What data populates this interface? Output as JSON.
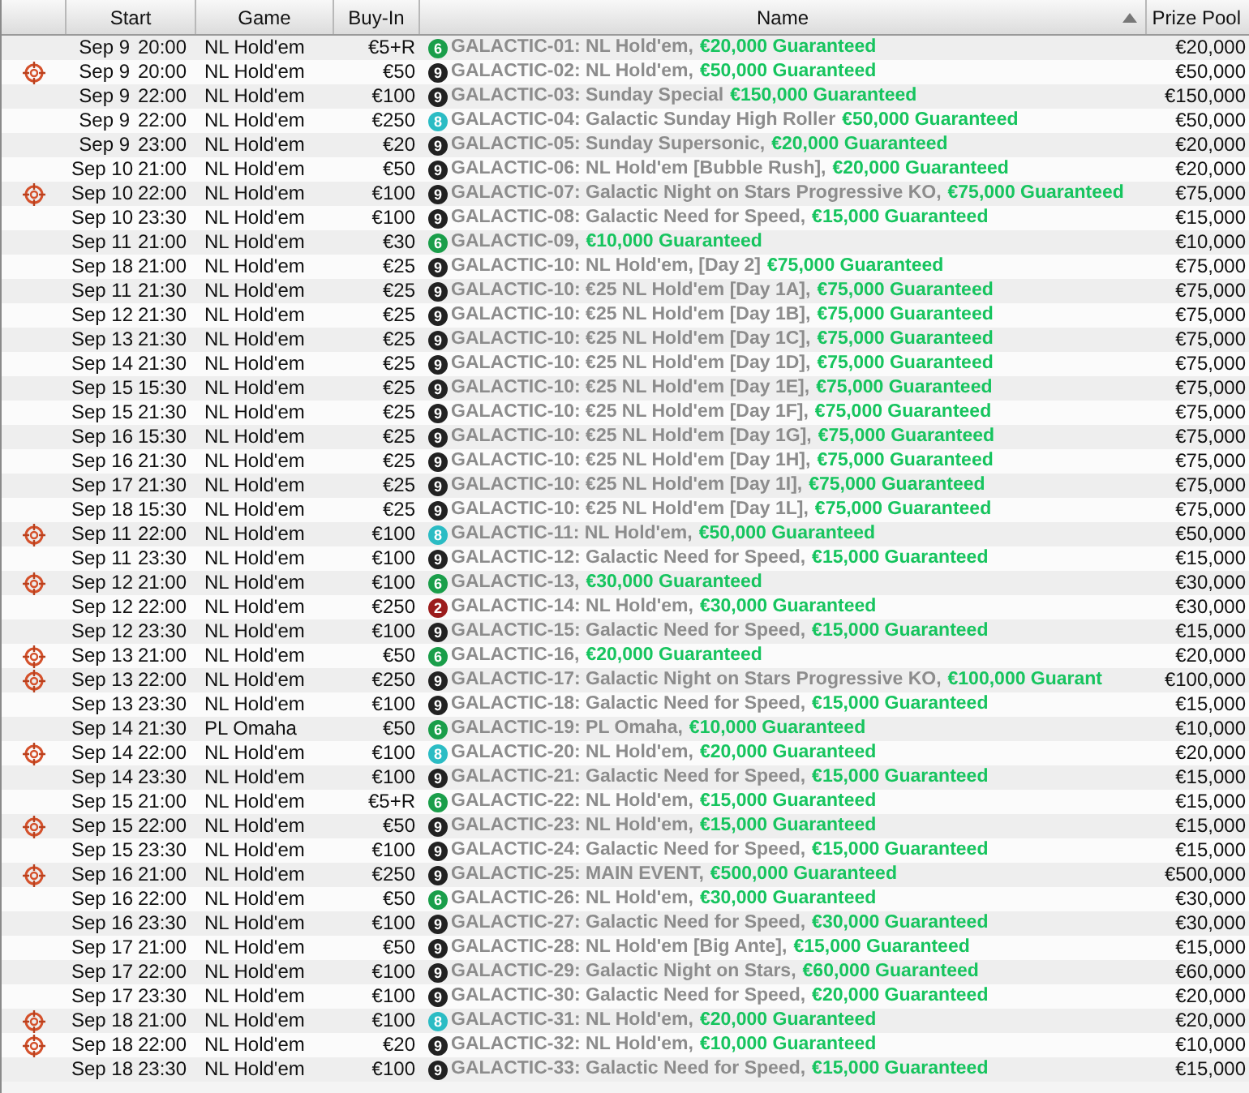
{
  "table": {
    "columns": [
      {
        "label": "Start"
      },
      {
        "label": "Game"
      },
      {
        "label": "Buy-In"
      },
      {
        "label": "Name",
        "sorted": true
      },
      {
        "label": "Prize Pool"
      }
    ],
    "rows": [
      {
        "marked": false,
        "date": "Sep 9",
        "time": "20:00",
        "game": "NL Hold'em",
        "buy_in": "€5+R",
        "seats": "6",
        "color": "#1a9e4a",
        "title": "GALACTIC-01: NL Hold'em,",
        "guarantee": "€20,000 Guaranteed",
        "prize_pool": "€20,000"
      },
      {
        "marked": true,
        "date": "Sep 9",
        "time": "20:00",
        "game": "NL Hold'em",
        "buy_in": "€50",
        "seats": "9",
        "color": "#222222",
        "title": "GALACTIC-02: NL Hold'em,",
        "guarantee": "€50,000 Guaranteed",
        "prize_pool": "€50,000"
      },
      {
        "marked": false,
        "date": "Sep 9",
        "time": "22:00",
        "game": "NL Hold'em",
        "buy_in": "€100",
        "seats": "9",
        "color": "#222222",
        "title": "GALACTIC-03: Sunday Special",
        "guarantee": "€150,000 Guaranteed",
        "prize_pool": "€150,000"
      },
      {
        "marked": false,
        "date": "Sep 9",
        "time": "22:00",
        "game": "NL Hold'em",
        "buy_in": "€250",
        "seats": "8",
        "color": "#2bbcc4",
        "title": "GALACTIC-04: Galactic Sunday High Roller",
        "guarantee": "€50,000 Guaranteed",
        "prize_pool": "€50,000"
      },
      {
        "marked": false,
        "date": "Sep 9",
        "time": "23:00",
        "game": "NL Hold'em",
        "buy_in": "€20",
        "seats": "9",
        "color": "#222222",
        "title": "GALACTIC-05: Sunday Supersonic,",
        "guarantee": "€20,000 Guaranteed",
        "prize_pool": "€20,000"
      },
      {
        "marked": false,
        "date": "Sep 10",
        "time": "21:00",
        "game": "NL Hold'em",
        "buy_in": "€50",
        "seats": "9",
        "color": "#222222",
        "title": "GALACTIC-06: NL Hold'em [Bubble Rush],",
        "guarantee": "€20,000 Guaranteed",
        "prize_pool": "€20,000"
      },
      {
        "marked": true,
        "date": "Sep 10",
        "time": "22:00",
        "game": "NL Hold'em",
        "buy_in": "€100",
        "seats": "9",
        "color": "#222222",
        "title": "GALACTIC-07: Galactic Night on Stars Progressive KO,",
        "guarantee": "€75,000 Guaranteed",
        "prize_pool": "€75,000"
      },
      {
        "marked": false,
        "date": "Sep 10",
        "time": "23:30",
        "game": "NL Hold'em",
        "buy_in": "€100",
        "seats": "9",
        "color": "#222222",
        "title": "GALACTIC-08: Galactic Need for Speed,",
        "guarantee": "€15,000 Guaranteed",
        "prize_pool": "€15,000"
      },
      {
        "marked": false,
        "date": "Sep 11",
        "time": "21:00",
        "game": "NL Hold'em",
        "buy_in": "€30",
        "seats": "6",
        "color": "#1a9e4a",
        "title": "GALACTIC-09,",
        "guarantee": "€10,000 Guaranteed",
        "prize_pool": "€10,000"
      },
      {
        "marked": false,
        "date": "Sep 18",
        "time": "21:00",
        "game": "NL Hold'em",
        "buy_in": "€25",
        "seats": "9",
        "color": "#222222",
        "title": "GALACTIC-10: NL Hold'em, [Day 2]",
        "guarantee": "€75,000 Guaranteed",
        "prize_pool": "€75,000"
      },
      {
        "marked": false,
        "date": "Sep 11",
        "time": "21:30",
        "game": "NL Hold'em",
        "buy_in": "€25",
        "seats": "9",
        "color": "#222222",
        "title": "GALACTIC-10: €25 NL Hold'em [Day 1A],",
        "guarantee": "€75,000 Guaranteed",
        "prize_pool": "€75,000"
      },
      {
        "marked": false,
        "date": "Sep 12",
        "time": "21:30",
        "game": "NL Hold'em",
        "buy_in": "€25",
        "seats": "9",
        "color": "#222222",
        "title": "GALACTIC-10: €25 NL Hold'em [Day 1B],",
        "guarantee": "€75,000 Guaranteed",
        "prize_pool": "€75,000"
      },
      {
        "marked": false,
        "date": "Sep 13",
        "time": "21:30",
        "game": "NL Hold'em",
        "buy_in": "€25",
        "seats": "9",
        "color": "#222222",
        "title": "GALACTIC-10: €25 NL Hold'em [Day 1C],",
        "guarantee": "€75,000 Guaranteed",
        "prize_pool": "€75,000"
      },
      {
        "marked": false,
        "date": "Sep 14",
        "time": "21:30",
        "game": "NL Hold'em",
        "buy_in": "€25",
        "seats": "9",
        "color": "#222222",
        "title": "GALACTIC-10: €25 NL Hold'em [Day 1D],",
        "guarantee": "€75,000 Guaranteed",
        "prize_pool": "€75,000"
      },
      {
        "marked": false,
        "date": "Sep 15",
        "time": "15:30",
        "game": "NL Hold'em",
        "buy_in": "€25",
        "seats": "9",
        "color": "#222222",
        "title": "GALACTIC-10: €25 NL Hold'em [Day 1E],",
        "guarantee": "€75,000 Guaranteed",
        "prize_pool": "€75,000"
      },
      {
        "marked": false,
        "date": "Sep 15",
        "time": "21:30",
        "game": "NL Hold'em",
        "buy_in": "€25",
        "seats": "9",
        "color": "#222222",
        "title": "GALACTIC-10: €25 NL Hold'em [Day 1F],",
        "guarantee": "€75,000 Guaranteed",
        "prize_pool": "€75,000"
      },
      {
        "marked": false,
        "date": "Sep 16",
        "time": "15:30",
        "game": "NL Hold'em",
        "buy_in": "€25",
        "seats": "9",
        "color": "#222222",
        "title": "GALACTIC-10: €25 NL Hold'em [Day 1G],",
        "guarantee": "€75,000 Guaranteed",
        "prize_pool": "€75,000"
      },
      {
        "marked": false,
        "date": "Sep 16",
        "time": "21:30",
        "game": "NL Hold'em",
        "buy_in": "€25",
        "seats": "9",
        "color": "#222222",
        "title": "GALACTIC-10: €25 NL Hold'em [Day 1H],",
        "guarantee": "€75,000 Guaranteed",
        "prize_pool": "€75,000"
      },
      {
        "marked": false,
        "date": "Sep 17",
        "time": "21:30",
        "game": "NL Hold'em",
        "buy_in": "€25",
        "seats": "9",
        "color": "#222222",
        "title": "GALACTIC-10: €25 NL Hold'em [Day 1I],",
        "guarantee": "€75,000 Guaranteed",
        "prize_pool": "€75,000"
      },
      {
        "marked": false,
        "date": "Sep 18",
        "time": "15:30",
        "game": "NL Hold'em",
        "buy_in": "€25",
        "seats": "9",
        "color": "#222222",
        "title": "GALACTIC-10: €25 NL Hold'em [Day 1L],",
        "guarantee": "€75,000 Guaranteed",
        "prize_pool": "€75,000"
      },
      {
        "marked": true,
        "date": "Sep 11",
        "time": "22:00",
        "game": "NL Hold'em",
        "buy_in": "€100",
        "seats": "8",
        "color": "#2bbcc4",
        "title": "GALACTIC-11: NL Hold'em,",
        "guarantee": "€50,000 Guaranteed",
        "prize_pool": "€50,000"
      },
      {
        "marked": false,
        "date": "Sep 11",
        "time": "23:30",
        "game": "NL Hold'em",
        "buy_in": "€100",
        "seats": "9",
        "color": "#222222",
        "title": "GALACTIC-12: Galactic Need for Speed,",
        "guarantee": "€15,000 Guaranteed",
        "prize_pool": "€15,000"
      },
      {
        "marked": true,
        "date": "Sep 12",
        "time": "21:00",
        "game": "NL Hold'em",
        "buy_in": "€100",
        "seats": "6",
        "color": "#1a9e4a",
        "title": "GALACTIC-13,",
        "guarantee": "€30,000 Guaranteed",
        "prize_pool": "€30,000"
      },
      {
        "marked": false,
        "date": "Sep 12",
        "time": "22:00",
        "game": "NL Hold'em",
        "buy_in": "€250",
        "seats": "2",
        "color": "#9b1c1c",
        "title": "GALACTIC-14: NL Hold'em,",
        "guarantee": "€30,000 Guaranteed",
        "prize_pool": "€30,000"
      },
      {
        "marked": false,
        "date": "Sep 12",
        "time": "23:30",
        "game": "NL Hold'em",
        "buy_in": "€100",
        "seats": "9",
        "color": "#222222",
        "title": "GALACTIC-15: Galactic Need for Speed,",
        "guarantee": "€15,000 Guaranteed",
        "prize_pool": "€15,000"
      },
      {
        "marked": true,
        "date": "Sep 13",
        "time": "21:00",
        "game": "NL Hold'em",
        "buy_in": "€50",
        "seats": "6",
        "color": "#1a9e4a",
        "title": "GALACTIC-16,",
        "guarantee": "€20,000 Guaranteed",
        "prize_pool": "€20,000"
      },
      {
        "marked": true,
        "date": "Sep 13",
        "time": "22:00",
        "game": "NL Hold'em",
        "buy_in": "€250",
        "seats": "9",
        "color": "#222222",
        "title": "GALACTIC-17: Galactic Night on Stars Progressive KO,",
        "guarantee": "€100,000 Guarant",
        "prize_pool": "€100,000"
      },
      {
        "marked": false,
        "date": "Sep 13",
        "time": "23:30",
        "game": "NL Hold'em",
        "buy_in": "€100",
        "seats": "9",
        "color": "#222222",
        "title": "GALACTIC-18: Galactic Need for Speed,",
        "guarantee": "€15,000 Guaranteed",
        "prize_pool": "€15,000"
      },
      {
        "marked": false,
        "date": "Sep 14",
        "time": "21:30",
        "game": "PL Omaha",
        "buy_in": "€50",
        "seats": "6",
        "color": "#1a9e4a",
        "title": "GALACTIC-19: PL Omaha,",
        "guarantee": "€10,000 Guaranteed",
        "prize_pool": "€10,000"
      },
      {
        "marked": true,
        "date": "Sep 14",
        "time": "22:00",
        "game": "NL Hold'em",
        "buy_in": "€100",
        "seats": "8",
        "color": "#2bbcc4",
        "title": "GALACTIC-20: NL Hold'em,",
        "guarantee": "€20,000 Guaranteed",
        "prize_pool": "€20,000"
      },
      {
        "marked": false,
        "date": "Sep 14",
        "time": "23:30",
        "game": "NL Hold'em",
        "buy_in": "€100",
        "seats": "9",
        "color": "#222222",
        "title": "GALACTIC-21: Galactic Need for Speed,",
        "guarantee": "€15,000 Guaranteed",
        "prize_pool": "€15,000"
      },
      {
        "marked": false,
        "date": "Sep 15",
        "time": "21:00",
        "game": "NL Hold'em",
        "buy_in": "€5+R",
        "seats": "6",
        "color": "#1a9e4a",
        "title": "GALACTIC-22: NL Hold'em,",
        "guarantee": "€15,000 Guaranteed",
        "prize_pool": "€15,000"
      },
      {
        "marked": true,
        "date": "Sep 15",
        "time": "22:00",
        "game": "NL Hold'em",
        "buy_in": "€50",
        "seats": "9",
        "color": "#222222",
        "title": "GALACTIC-23: NL Hold'em,",
        "guarantee": "€15,000 Guaranteed",
        "prize_pool": "€15,000"
      },
      {
        "marked": false,
        "date": "Sep 15",
        "time": "23:30",
        "game": "NL Hold'em",
        "buy_in": "€100",
        "seats": "9",
        "color": "#222222",
        "title": "GALACTIC-24: Galactic Need for Speed,",
        "guarantee": "€15,000 Guaranteed",
        "prize_pool": "€15,000"
      },
      {
        "marked": true,
        "date": "Sep 16",
        "time": "21:00",
        "game": "NL Hold'em",
        "buy_in": "€250",
        "seats": "9",
        "color": "#222222",
        "title": "GALACTIC-25: MAIN EVENT,",
        "guarantee": "€500,000 Guaranteed",
        "prize_pool": "€500,000"
      },
      {
        "marked": false,
        "date": "Sep 16",
        "time": "22:00",
        "game": "NL Hold'em",
        "buy_in": "€50",
        "seats": "6",
        "color": "#1a9e4a",
        "title": "GALACTIC-26: NL Hold'em,",
        "guarantee": "€30,000 Guaranteed",
        "prize_pool": "€30,000"
      },
      {
        "marked": false,
        "date": "Sep 16",
        "time": "23:30",
        "game": "NL Hold'em",
        "buy_in": "€100",
        "seats": "9",
        "color": "#222222",
        "title": "GALACTIC-27: Galactic Need for Speed,",
        "guarantee": "€30,000 Guaranteed",
        "prize_pool": "€30,000"
      },
      {
        "marked": false,
        "date": "Sep 17",
        "time": "21:00",
        "game": "NL Hold'em",
        "buy_in": "€50",
        "seats": "9",
        "color": "#222222",
        "title": "GALACTIC-28: NL Hold'em [Big Ante],",
        "guarantee": "€15,000 Guaranteed",
        "prize_pool": "€15,000"
      },
      {
        "marked": false,
        "date": "Sep 17",
        "time": "22:00",
        "game": "NL Hold'em",
        "buy_in": "€100",
        "seats": "9",
        "color": "#222222",
        "title": "GALACTIC-29: Galactic Night on Stars,",
        "guarantee": "€60,000 Guaranteed",
        "prize_pool": "€60,000"
      },
      {
        "marked": false,
        "date": "Sep 17",
        "time": "23:30",
        "game": "NL Hold'em",
        "buy_in": "€100",
        "seats": "9",
        "color": "#222222",
        "title": "GALACTIC-30: Galactic Need for Speed,",
        "guarantee": "€20,000 Guaranteed",
        "prize_pool": "€20,000"
      },
      {
        "marked": true,
        "date": "Sep 18",
        "time": "21:00",
        "game": "NL Hold'em",
        "buy_in": "€100",
        "seats": "8",
        "color": "#2bbcc4",
        "title": "GALACTIC-31: NL Hold'em,",
        "guarantee": "€20,000 Guaranteed",
        "prize_pool": "€20,000"
      },
      {
        "marked": true,
        "date": "Sep 18",
        "time": "22:00",
        "game": "NL Hold'em",
        "buy_in": "€20",
        "seats": "9",
        "color": "#222222",
        "title": "GALACTIC-32: NL Hold'em,",
        "guarantee": "€10,000 Guaranteed",
        "prize_pool": "€10,000"
      },
      {
        "marked": false,
        "date": "Sep 18",
        "time": "23:30",
        "game": "NL Hold'em",
        "buy_in": "€100",
        "seats": "9",
        "color": "#222222",
        "title": "GALACTIC-33: Galactic Need for Speed,",
        "guarantee": "€15,000 Guaranteed",
        "prize_pool": "€15,000"
      }
    ]
  }
}
